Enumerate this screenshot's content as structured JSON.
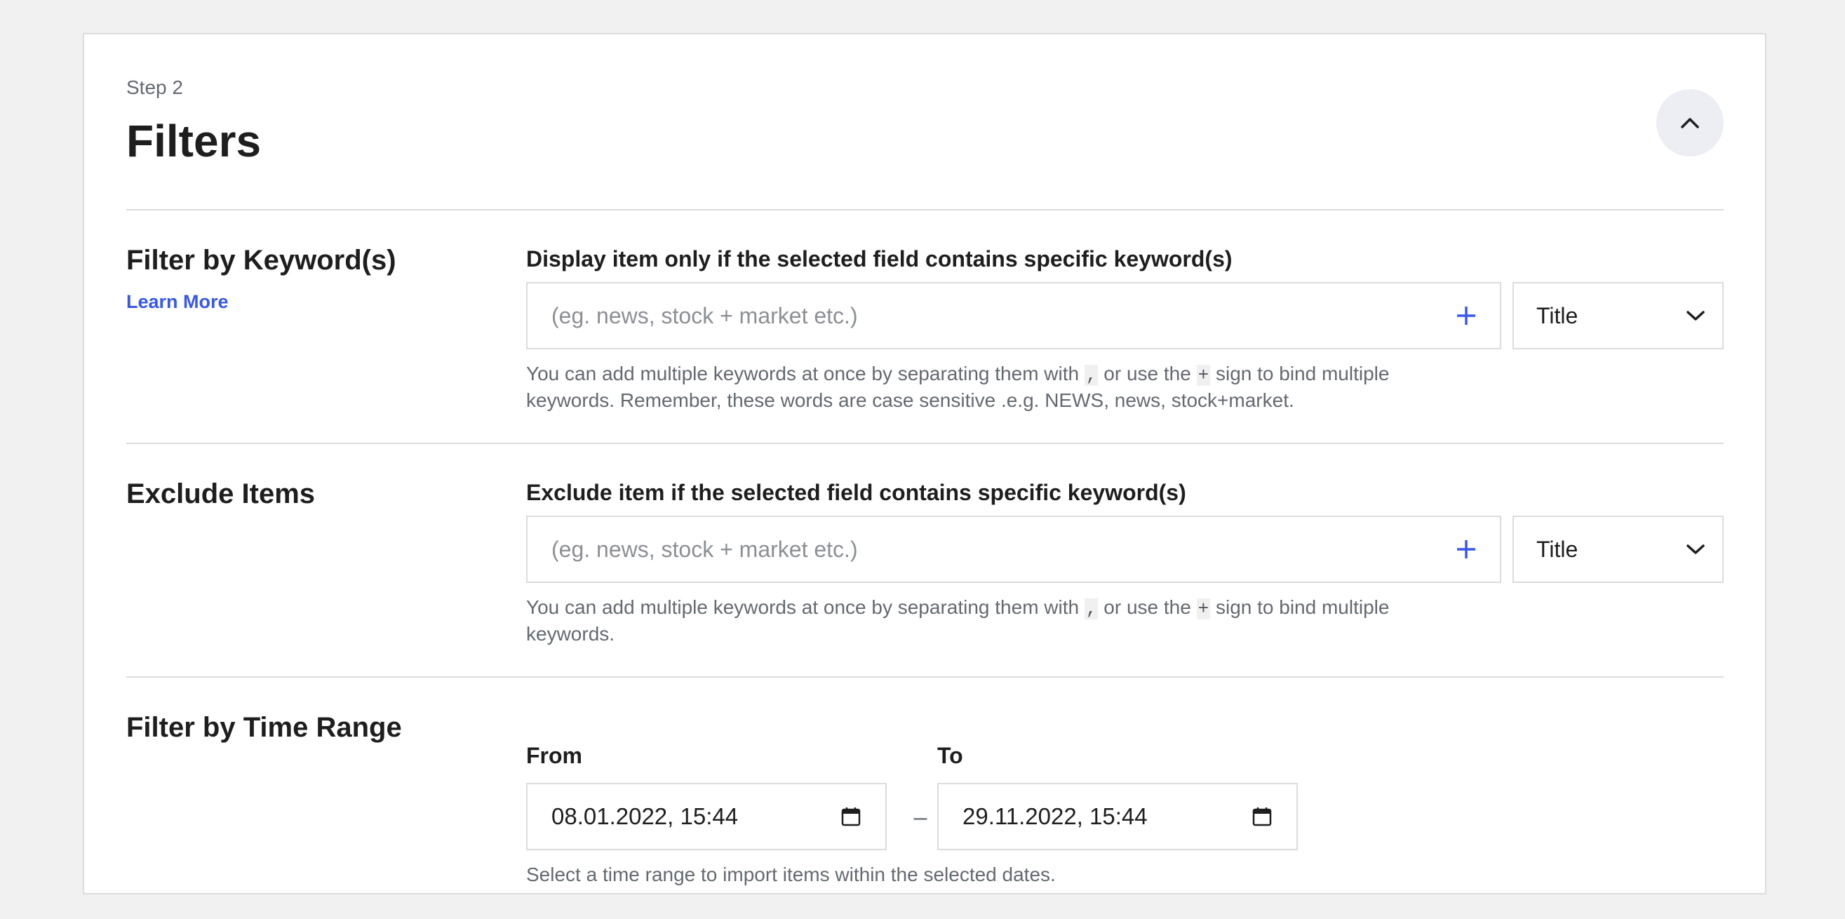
{
  "header": {
    "step": "Step 2",
    "title": "Filters"
  },
  "keyword_filter": {
    "section_title": "Filter by Keyword(s)",
    "learn_more": "Learn More",
    "label": "Display item only if the selected field contains specific keyword(s)",
    "placeholder": "(eg. news, stock + market etc.)",
    "field_select": "Title",
    "help_prefix": "You can add multiple keywords at once by separating them with",
    "help_comma": ",",
    "help_middle": "or use the",
    "help_plus": "+",
    "help_suffix": "sign to bind multiple keywords. Remember, these words are case sensitive .e.g. NEWS, news, stock+market."
  },
  "exclude_filter": {
    "section_title": "Exclude Items",
    "label": "Exclude item if the selected field contains specific keyword(s)",
    "placeholder": "(eg. news, stock + market etc.)",
    "field_select": "Title",
    "help_prefix": "You can add multiple keywords at once by separating them with",
    "help_comma": ",",
    "help_middle": "or use the",
    "help_plus": "+",
    "help_suffix": "sign to bind multiple keywords."
  },
  "time_filter": {
    "section_title": "Filter by Time Range",
    "from_label": "From",
    "from_value": "08.01.2022, 15:44",
    "separator": "–",
    "to_label": "To",
    "to_value": "29.11.2022, 15:44",
    "help": "Select a time range to import items within the selected dates."
  },
  "colors": {
    "accent": "#3858e9",
    "border": "#dcdcde",
    "muted_text": "#646970",
    "background": "#f1f1f1"
  }
}
